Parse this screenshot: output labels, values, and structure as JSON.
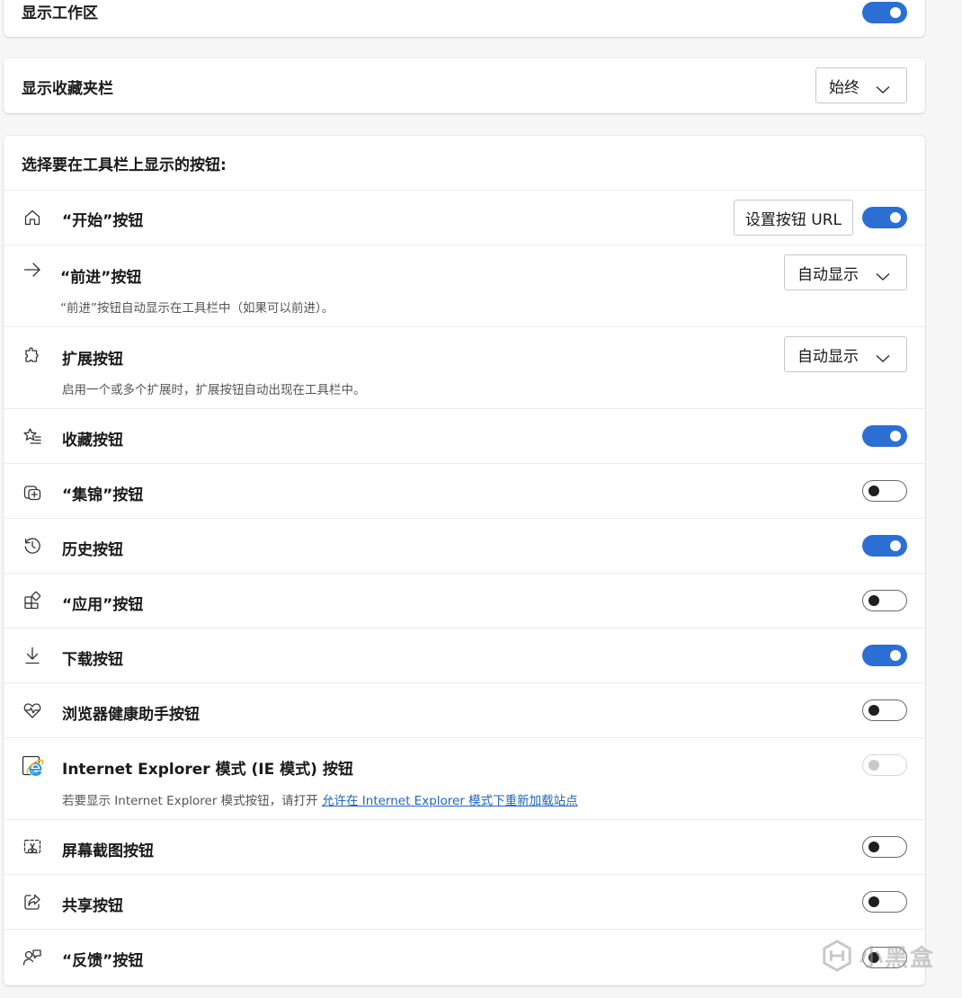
{
  "top": {
    "show_workspaces": {
      "label": "显示工作区",
      "enabled": true
    },
    "favorites_bar": {
      "label": "显示收藏夹栏",
      "value": "始终"
    }
  },
  "toolbar": {
    "header": "选择要在工具栏上显示的按钮:",
    "items": [
      {
        "label": "“开始”按钮",
        "icon": "home-icon",
        "extra_button": "设置按钮 URL",
        "enabled": true
      },
      {
        "label": "“前进”按钮",
        "icon": "arrow-right-icon",
        "desc": "“前进”按钮自动显示在工具栏中（如果可以前进）。",
        "select": "自动显示"
      },
      {
        "label": "扩展按钮",
        "icon": "puzzle-icon",
        "desc": "启用一个或多个扩展时，扩展按钮自动出现在工具栏中。",
        "select": "自动显示"
      },
      {
        "label": "收藏按钮",
        "icon": "star-list-icon",
        "enabled": true
      },
      {
        "label": "“集锦”按钮",
        "icon": "collections-icon",
        "enabled": false
      },
      {
        "label": "历史按钮",
        "icon": "history-icon",
        "enabled": true
      },
      {
        "label": "“应用”按钮",
        "icon": "apps-icon",
        "enabled": false
      },
      {
        "label": "下载按钮",
        "icon": "download-icon",
        "enabled": true
      },
      {
        "label": "浏览器健康助手按钮",
        "icon": "heart-pulse-icon",
        "enabled": false
      },
      {
        "label": "Internet Explorer 模式 (IE 模式) 按钮",
        "icon": "ie-icon",
        "desc_prefix": "若要显示 Internet Explorer 模式按钮，请打开 ",
        "desc_link": "允许在 Internet Explorer 模式下重新加载站点",
        "enabled": false,
        "disabled": true
      },
      {
        "label": "屏幕截图按钮",
        "icon": "screenshot-icon",
        "enabled": false
      },
      {
        "label": "共享按钮",
        "icon": "share-icon",
        "enabled": false
      },
      {
        "label": "“反馈”按钮",
        "icon": "feedback-icon",
        "enabled": false
      }
    ]
  },
  "watermark": {
    "text": "小黑盒"
  },
  "colors": {
    "accent": "#2b6fd4",
    "link": "#1f66c1"
  }
}
